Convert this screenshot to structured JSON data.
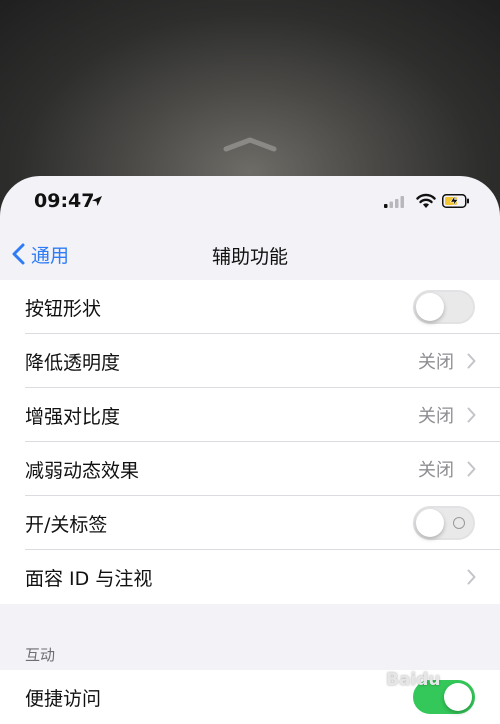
{
  "status_bar": {
    "time": "09:47"
  },
  "nav": {
    "back_label": "通用",
    "title": "辅助功能"
  },
  "rows": [
    {
      "label": "按钮形状",
      "type": "toggle",
      "on": false
    },
    {
      "label": "降低透明度",
      "type": "disclosure",
      "value": "关闭"
    },
    {
      "label": "增强对比度",
      "type": "disclosure",
      "value": "关闭"
    },
    {
      "label": "减弱动态效果",
      "type": "disclosure",
      "value": "关闭"
    },
    {
      "label": "开/关标签",
      "type": "toggle",
      "on": false
    },
    {
      "label": "面容 ID 与注视",
      "type": "disclosure",
      "value": ""
    }
  ],
  "interaction_section": {
    "header": "互动",
    "rows": [
      {
        "label": "便捷访问",
        "type": "toggle",
        "on": true
      }
    ]
  },
  "watermark": "Baidu",
  "colors": {
    "accent": "#2f7cf6",
    "toggle_on": "#34c759",
    "background": "#f2f2f7"
  }
}
